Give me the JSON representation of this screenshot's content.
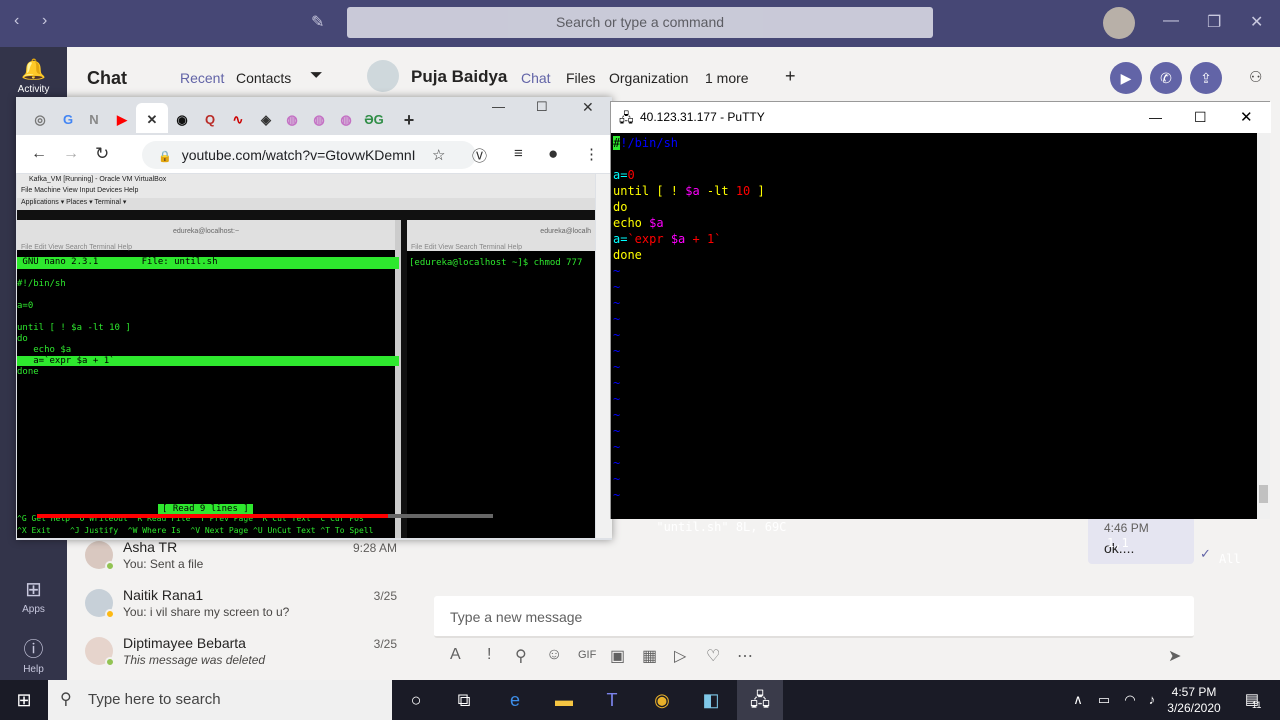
{
  "teams": {
    "search_placeholder": "Search or type a command",
    "rail": [
      {
        "label": "Activity",
        "icon": "bell-icon"
      },
      {
        "label": "Apps",
        "icon": "apps-icon"
      },
      {
        "label": "Help",
        "icon": "help-icon"
      }
    ],
    "chat_heading": "Chat",
    "chat_tabs": [
      "Recent",
      "Contacts"
    ],
    "contact_name": "Puja Baidya",
    "header_tabs": [
      "Chat",
      "Files",
      "Organization",
      "1 more"
    ],
    "chats": [
      {
        "name": "Asha TR",
        "preview": "You: Sent a file",
        "time": "9:28 AM",
        "status": "#92c353"
      },
      {
        "name": "Naitik Rana1",
        "preview": "You: i vil share my screen to u?",
        "time": "3/25",
        "status": "#fdb913"
      },
      {
        "name": "Diptimayee Bebarta",
        "preview": "This message was deleted",
        "time": "3/25",
        "status": "#92c353"
      }
    ],
    "last_message": {
      "time": "4:46 PM",
      "text": "ok...."
    },
    "compose_placeholder": "Type a new message",
    "accent": "#6264a7"
  },
  "chrome": {
    "url": "youtube.com/watch?v=GtovwKDemnI",
    "video": {
      "vm_title": "Kafka_VM [Running] - Oracle VM VirtualBox",
      "vm_menu": "File   Machine   View   Input   Devices   Help",
      "gnome_bar": "Applications ▾    Places ▾    Terminal ▾",
      "term1_title": "edureka@localhost:~",
      "term_menu": "File  Edit  View  Search  Terminal  Help",
      "term2_title": "edureka@localh",
      "term2_line": "[edureka@localhost ~]$ chmod 777",
      "nano_header": " GNU nano 2.3.1        File: until.sh",
      "nano_lines": [
        "#!/bin/sh",
        "",
        "a=0",
        "",
        "until [ ! $a -lt 10 ]",
        "do",
        "   echo $a",
        "   a=`expr $a + 1`",
        "done"
      ],
      "nano_status": "[ Read 9 lines ]",
      "nano_help1": "^G Get Help ^O WriteOut ^R Read File ^Y Prev Page ^K Cut Text ^C Cur Pos",
      "nano_help2": "^X Exit    ^J Justify  ^W Where Is  ^V Next Page ^U UnCut Text ^T To Spell",
      "progress": 0.77
    }
  },
  "putty": {
    "title": "40.123.31.177 - PuTTY",
    "status_file": "\"until.sh\" 8L, 69C",
    "status_pos": "1,1",
    "status_all": "All"
  },
  "taskbar": {
    "search_placeholder": "Type here to search",
    "time": "4:57 PM",
    "date": "3/26/2020",
    "notifications": "11"
  }
}
